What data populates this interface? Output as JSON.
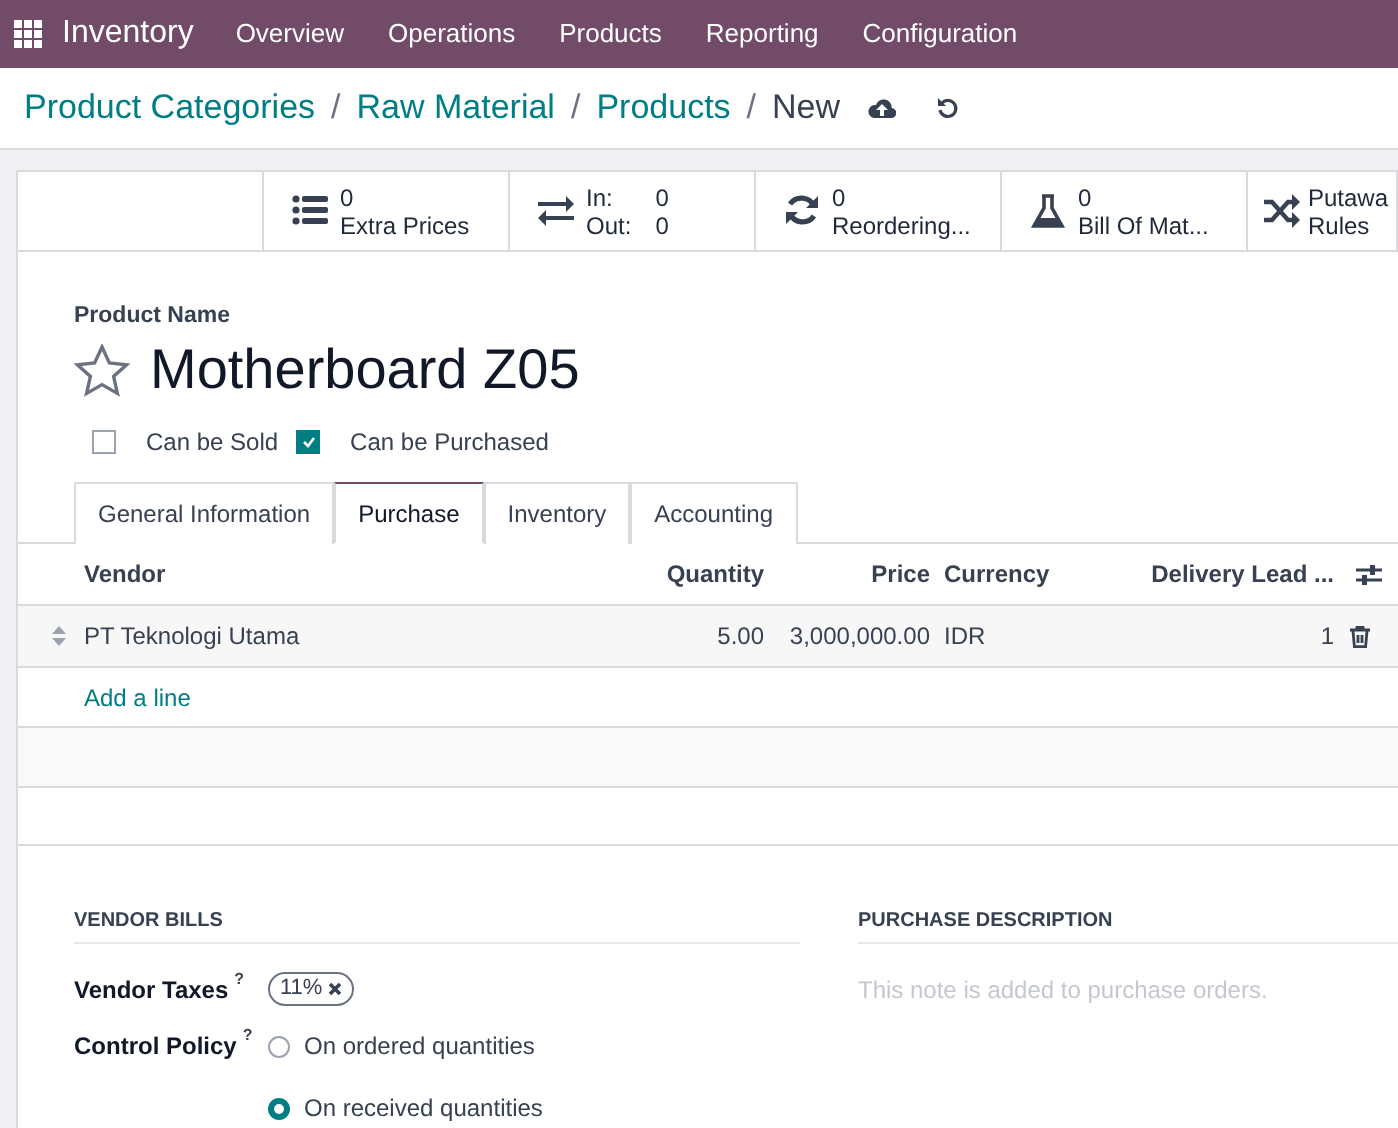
{
  "navbar": {
    "app": "Inventory",
    "menu": [
      "Overview",
      "Operations",
      "Products",
      "Reporting",
      "Configuration"
    ]
  },
  "breadcrumbs": [
    {
      "label": "Product Categories",
      "separator": "/"
    },
    {
      "label": "Raw Material",
      "separator": "/"
    },
    {
      "label": "Products",
      "separator": "/"
    },
    {
      "label": "New"
    }
  ],
  "smart_buttons": [
    {
      "kind": "stat",
      "value": "0",
      "label": "Extra Prices"
    },
    {
      "kind": "inout",
      "in_label": "In:",
      "in_value": "0",
      "out_label": "Out:",
      "out_value": "0"
    },
    {
      "kind": "stat",
      "value": "0",
      "label": "Reordering..."
    },
    {
      "kind": "stat",
      "value": "0",
      "label": "Bill Of Mat..."
    },
    {
      "kind": "stat",
      "value": "Putawa",
      "label": "Rules"
    }
  ],
  "product": {
    "name_label": "Product Name",
    "name": "Motherboard Z05",
    "favorite": false
  },
  "options": [
    {
      "label": "Can be Sold",
      "checked": false
    },
    {
      "label": "Can be Purchased",
      "checked": true
    }
  ],
  "tabs": [
    {
      "label": "General Information",
      "selected": false
    },
    {
      "label": "Purchase",
      "selected": true
    },
    {
      "label": "Inventory",
      "selected": false
    },
    {
      "label": "Accounting",
      "selected": false
    }
  ],
  "table": {
    "columns": [
      "Vendor",
      "Quantity",
      "Price",
      "Currency",
      "Delivery Lead ..."
    ],
    "rows": [
      [
        "PT Teknologi Utama",
        "5.00",
        "3,000,000.00",
        "IDR",
        "1"
      ]
    ],
    "add_line": "Add a line"
  },
  "vendor_bills": {
    "title": "VENDOR BILLS",
    "taxes_label": "Vendor Taxes",
    "taxes_help": "?",
    "taxes": [
      "11%"
    ],
    "policy_label": "Control Policy",
    "policy_help": "?",
    "policy_options": [
      {
        "label": "On ordered quantities",
        "selected": false
      },
      {
        "label": "On received quantities",
        "selected": true
      }
    ]
  },
  "purchase_description": {
    "title": "PURCHASE DESCRIPTION",
    "placeholder": "This note is added to purchase orders."
  }
}
